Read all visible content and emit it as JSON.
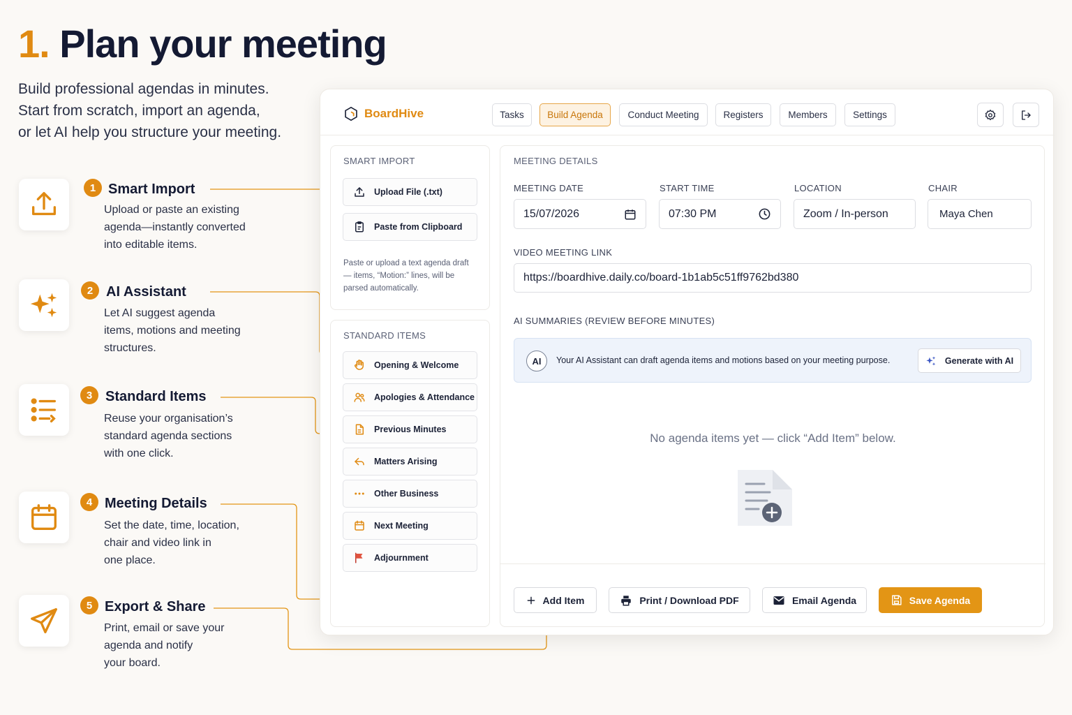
{
  "hero": {
    "number": "1.",
    "title": "Plan your meeting",
    "subtitle_lines": [
      "Build professional agendas in minutes.",
      "Start from scratch, import an agenda,",
      "or let AI help you structure your meeting."
    ]
  },
  "features": [
    {
      "num": "1",
      "title": "Smart Import",
      "desc_lines": [
        "Upload or paste an existing",
        "agenda—instantly converted",
        "into editable items."
      ],
      "icon": "upload-icon"
    },
    {
      "num": "2",
      "title": "AI Assistant",
      "desc_lines": [
        "Let AI suggest agenda",
        "items, motions and meeting",
        "structures."
      ],
      "icon": "sparkles-icon"
    },
    {
      "num": "3",
      "title": "Standard Items",
      "desc_lines": [
        "Reuse your organisation’s",
        "standard agenda sections",
        "with one click."
      ],
      "icon": "list-icon"
    },
    {
      "num": "4",
      "title": "Meeting Details",
      "desc_lines": [
        "Set the date, time, location,",
        "chair and video link in",
        "one place."
      ],
      "icon": "calendar-icon"
    },
    {
      "num": "5",
      "title": "Export & Share",
      "desc_lines": [
        "Print, email or save your",
        "agenda and notify",
        "your board."
      ],
      "icon": "send-icon"
    }
  ],
  "app": {
    "brand": "BoardHive",
    "nav": [
      "Tasks",
      "Build Agenda",
      "Conduct Meeting",
      "Registers",
      "Members",
      "Settings"
    ],
    "active_nav": "Build Agenda",
    "smart_import": {
      "heading": "SMART IMPORT",
      "upload_label": "Upload File (.txt)",
      "paste_label": "Paste from Clipboard",
      "hint_lines": [
        "Paste or upload a text agenda draft",
        "— items, “Motion:” lines, will be",
        "parsed automatically."
      ]
    },
    "standard_items": {
      "heading": "STANDARD ITEMS",
      "items": [
        "Opening & Welcome",
        "Apologies & Attendance",
        "Previous Minutes",
        "Matters Arising",
        "Other Business",
        "Next Meeting",
        "Adjournment"
      ]
    },
    "meeting_details": {
      "heading": "MEETING DETAILS",
      "date_label": "MEETING DATE",
      "date_value": "15/07/2026",
      "time_label": "START TIME",
      "time_value": "07:30 PM",
      "location_label": "LOCATION",
      "location_value": "Zoom / In-person",
      "chair_label": "CHAIR",
      "chair_value": "Maya Chen",
      "video_label": "VIDEO MEETING LINK",
      "video_value": "https://boardhive.daily.co/board-1b1ab5c51ff9762bd380"
    },
    "ai": {
      "heading": "AI SUMMARIES (REVIEW BEFORE MINUTES)",
      "badge": "AI",
      "message": "Your AI Assistant can draft agenda items and motions based on your meeting purpose.",
      "generate_label": "Generate with AI"
    },
    "empty_state": "No agenda items yet — click “Add Item” below.",
    "actions": {
      "add": "Add Item",
      "print": "Print / Download PDF",
      "email": "Email Agenda",
      "save": "Save Agenda"
    }
  },
  "colors": {
    "accent": "#e08a12",
    "navy": "#141a33",
    "ai_bg": "#eef3fb"
  }
}
